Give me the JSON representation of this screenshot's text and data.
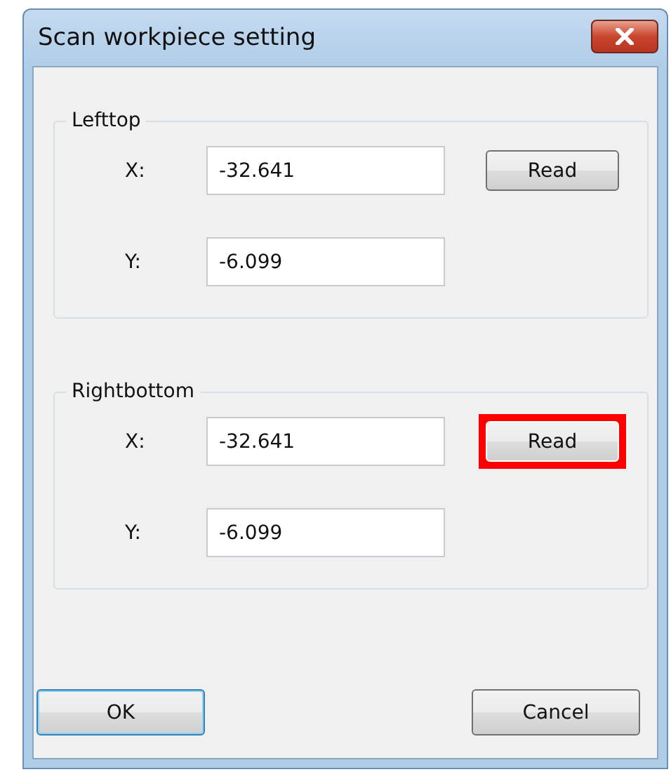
{
  "window": {
    "title": "Scan workpiece setting"
  },
  "groups": [
    {
      "title": "Lefttop",
      "fields": [
        {
          "label": "X:",
          "value": "-32.641"
        },
        {
          "label": "Y:",
          "value": "-6.099"
        }
      ],
      "read_button": {
        "label": "Read",
        "highlighted": false
      }
    },
    {
      "title": "Rightbottom",
      "fields": [
        {
          "label": "X:",
          "value": "-32.641"
        },
        {
          "label": "Y:",
          "value": "-6.099"
        }
      ],
      "read_button": {
        "label": "Read",
        "highlighted": true
      }
    }
  ],
  "buttons": [
    {
      "label": "OK",
      "default": true
    },
    {
      "label": "Cancel",
      "default": false
    }
  ]
}
